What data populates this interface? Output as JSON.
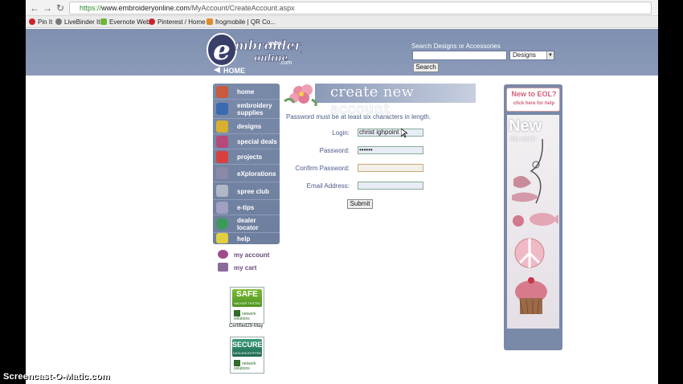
{
  "browser": {
    "url_scheme": "https://",
    "url_host": "www.embroideryonline.com",
    "url_path": "/MyAccount/CreateAccount.aspx",
    "bookmarks": [
      {
        "label": "Pin It",
        "color": "#c8232c"
      },
      {
        "label": "LiveBinder It",
        "color": "#777777"
      },
      {
        "label": "Evernote Web",
        "color": "#6fb536"
      },
      {
        "label": "Pinterest / Home",
        "color": "#c8232c"
      },
      {
        "label": "frogmobile | QR Co...",
        "color": "#e08a2a"
      }
    ]
  },
  "header": {
    "search_label": "Search Designs or Accessories",
    "category_value": "Designs",
    "search_button": "Search",
    "logo_letter": "e",
    "logo_word": "mbroidery",
    "logo_sub": "online",
    "logo_dotcom": ".com",
    "logo_www": "www.",
    "logo_home": "HOME"
  },
  "nav": {
    "items": [
      {
        "label": "home",
        "color": "#c85a40"
      },
      {
        "label": "embroidery supplies",
        "color": "#3a6ab0"
      },
      {
        "label": "designs",
        "color": "#d8b030"
      },
      {
        "label": "special deals",
        "color": "#b54a7a"
      },
      {
        "label": "projects",
        "color": "#d84040"
      },
      {
        "label": "eXplorations",
        "color": "#8a8aa8"
      },
      {
        "label": "spree club",
        "color": "#b0b8c8"
      },
      {
        "label": "e-tips",
        "color": "#a0a0c0"
      },
      {
        "label": "dealer locator",
        "color": "#3a9a5a"
      },
      {
        "label": "help",
        "color": "#e0d040"
      }
    ],
    "my_account": "my account",
    "my_cart": "my cart"
  },
  "badges": {
    "safe_title": "SAFE",
    "safe_sub": "HACKER TESTED",
    "secure_title": "SECURE",
    "secure_sub": "DATA ENCRYPTED",
    "ns_text": "network solutions",
    "cert_text": "Certified29-May"
  },
  "form": {
    "title": "create new account",
    "password_note": "Password must be at least six characters in length.",
    "login_label": "Login:",
    "login_value": "christ  ighpoint",
    "password_label": "Password:",
    "password_value": "••••••",
    "confirm_label": "Confirm Password:",
    "confirm_value": "",
    "email_label": "Email Address:",
    "email_value": "",
    "submit_label": "Submit"
  },
  "ad": {
    "new_title": "New to EOL?",
    "new_sub": "click here for help",
    "big": "New",
    "small": "this month"
  },
  "watermark": "Screencast-O-Matic.com",
  "colors": {
    "header_bg": "#8b9ab8",
    "nav_bg": "#7989a8",
    "form_text": "#4a5a8a",
    "accent_pink": "#d2607a"
  }
}
